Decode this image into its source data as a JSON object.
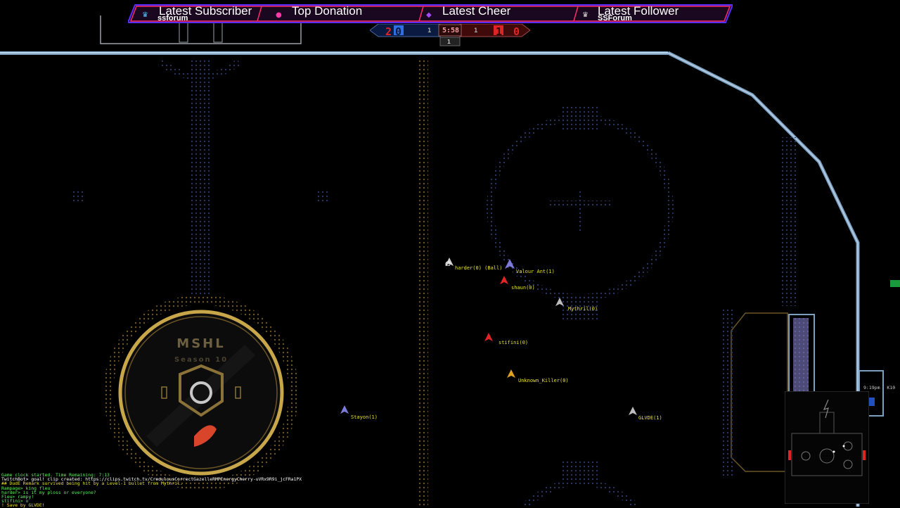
{
  "overlay": {
    "latest_subscriber_label": "Latest Subscriber",
    "latest_subscriber_name": "ssforum",
    "top_donation_label": "Top Donation",
    "latest_cheer_label": "Latest Cheer",
    "latest_follower_label": "Latest Follower",
    "latest_follower_name": "SSForum",
    "bar_accent": "#ff2a6a",
    "bar_glow": "#5a2cff"
  },
  "scoreboard": {
    "left_score": "2",
    "left_box": "0",
    "left_small": "1",
    "time": "5:58",
    "right_small": "1",
    "right_box": "1",
    "right_score": "0",
    "period": "1",
    "left_color": "#2f6fe0",
    "right_color": "#e02424"
  },
  "logo": {
    "title": "MSHL",
    "season": "Season 10",
    "ring_color": "#c8a64a"
  },
  "players": [
    {
      "id": "harder",
      "label": "harder(0) (Ball)",
      "color": "#e8e030",
      "ship": "#cfcfcf"
    },
    {
      "id": "valour",
      "label": "Valour Ant(1)",
      "color": "#e8e030",
      "ship": "#7d7ad8"
    },
    {
      "id": "shaun",
      "label": "shaun(0)",
      "color": "#e8e030",
      "ship": "#e02424"
    },
    {
      "id": "mythril",
      "label": "Mythril(0)",
      "color": "#e8e030",
      "ship": "#bdbdbd"
    },
    {
      "id": "stifini",
      "label": "stifini(0)",
      "color": "#e8e030",
      "ship": "#e02424"
    },
    {
      "id": "unknown-killer",
      "label": "Unknown_Killer(0)",
      "color": "#e8e030",
      "ship": "#e0a020"
    },
    {
      "id": "stayon",
      "label": "Stayon(1)",
      "color": "#e8e030",
      "ship": "#7d7ad8"
    },
    {
      "id": "glvde",
      "label": "GLVDE(1)",
      "color": "#e8e030",
      "ship": "#bdbdbd"
    }
  ],
  "chat": [
    {
      "text": "Game clock started. Time Remaining: 7:13",
      "color": "#5cf05c"
    },
    {
      "text": " TwitchBot> goal! clip created: https://clips.twitch.tv/CredulousCorrectGazelleRMPEnergyCherry-uVRx9R9i_jcFRa1PX",
      "color": "#ffffff"
    },
    {
      "text": " ## DudE Remark survived being hit by a Level-1 bullet from Mythril.",
      "color": "#e8e030"
    },
    {
      "text": "  Rampage> king fleu",
      "color": "#5cf05c"
    },
    {
      "text": "    harder> is it my ploss or everyone?",
      "color": "#5cf05c"
    },
    {
      "text": "     Fleu> rampy!",
      "color": "#5cf05c"
    },
    {
      "text": "   stifini> o",
      "color": "#5cf05c"
    },
    {
      "text": "  ! Save by GLVDE!",
      "color": "#e8e030"
    }
  ],
  "radar": {
    "clock": "9:19pm",
    "sector": "K10"
  },
  "colors": {
    "wall": "#7d9fc0",
    "dot_blue": "#2a3560",
    "dot_gold": "#6b5526"
  }
}
